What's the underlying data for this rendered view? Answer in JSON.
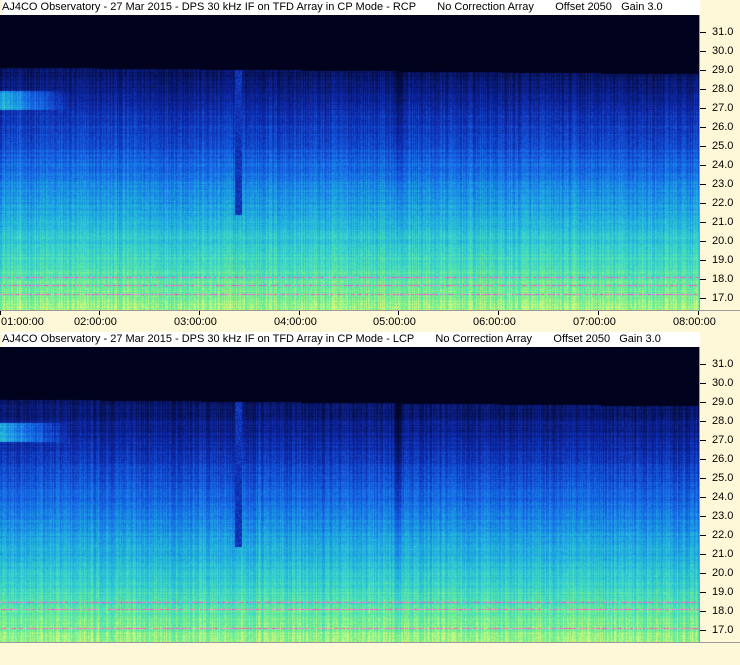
{
  "panels": [
    {
      "id": "rcp",
      "title": "AJ4CO Observatory - 27 Mar 2015 - DPS 30 kHz IF on TFD Array in CP Mode - RCP       No Correction Array       Offset 2050   Gain 3.0",
      "freq_labels": [
        "31.0",
        "30.0",
        "29.0",
        "28.0",
        "27.0",
        "26.0",
        "25.0",
        "24.0",
        "23.0",
        "22.0",
        "21.0",
        "20.0",
        "19.0",
        "18.0",
        "17.0"
      ],
      "time_labels": [
        "01:00:00",
        "02:00:00",
        "03:00:00",
        "04:00:00",
        "05:00:00",
        "06:00:00",
        "07:00:00",
        "08:00:00"
      ]
    },
    {
      "id": "lcp",
      "title": "AJ4CO Observatory - 27 Mar 2015 - DPS 30 kHz IF on TFD Array in CP Mode - LCP       No Correction Array       Offset 2050   Gain 3.0",
      "freq_labels": [
        "31.0",
        "30.0",
        "29.0",
        "28.0",
        "27.0",
        "26.0",
        "25.0",
        "24.0",
        "23.0",
        "22.0",
        "21.0",
        "20.0",
        "19.0",
        "18.0",
        "17.0"
      ],
      "time_labels": []
    }
  ],
  "colors": {
    "axis_bg": "#fff8d8",
    "sky_dark": "#000018",
    "deep_blue": "#0a1c80",
    "mid_blue": "#1a66e0",
    "cyan": "#22b8d8",
    "green": "#70e890",
    "interference_magenta": "#ff40c0"
  }
}
